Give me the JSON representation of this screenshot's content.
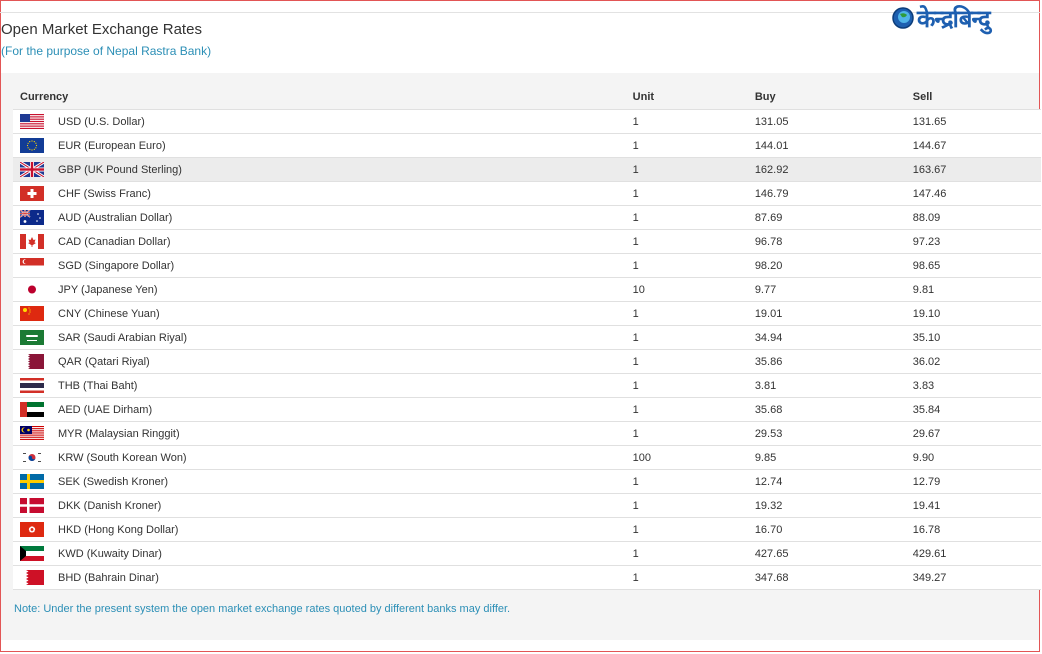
{
  "header": {
    "title": "Open Market Exchange Rates",
    "subtitle": "(For the purpose of Nepal Rastra Bank)",
    "logo_text": "केन्द्रबिन्दु"
  },
  "table": {
    "headers": {
      "currency": "Currency",
      "unit": "Unit",
      "buy": "Buy",
      "sell": "Sell"
    },
    "rows": [
      {
        "flag": "us-flag-icon",
        "currency": "USD (U.S. Dollar)",
        "unit": "1",
        "buy": "131.05",
        "sell": "131.65"
      },
      {
        "flag": "eu-flag-icon",
        "currency": "EUR (European Euro)",
        "unit": "1",
        "buy": "144.01",
        "sell": "144.67"
      },
      {
        "flag": "gb-flag-icon",
        "currency": "GBP (UK Pound Sterling)",
        "unit": "1",
        "buy": "162.92",
        "sell": "163.67"
      },
      {
        "flag": "ch-flag-icon",
        "currency": "CHF (Swiss Franc)",
        "unit": "1",
        "buy": "146.79",
        "sell": "147.46"
      },
      {
        "flag": "au-flag-icon",
        "currency": "AUD (Australian Dollar)",
        "unit": "1",
        "buy": "87.69",
        "sell": "88.09"
      },
      {
        "flag": "ca-flag-icon",
        "currency": "CAD (Canadian Dollar)",
        "unit": "1",
        "buy": "96.78",
        "sell": "97.23"
      },
      {
        "flag": "sg-flag-icon",
        "currency": "SGD (Singapore Dollar)",
        "unit": "1",
        "buy": "98.20",
        "sell": "98.65"
      },
      {
        "flag": "jp-flag-icon",
        "currency": "JPY (Japanese Yen)",
        "unit": "10",
        "buy": "9.77",
        "sell": "9.81"
      },
      {
        "flag": "cn-flag-icon",
        "currency": "CNY (Chinese Yuan)",
        "unit": "1",
        "buy": "19.01",
        "sell": "19.10"
      },
      {
        "flag": "sa-flag-icon",
        "currency": "SAR (Saudi Arabian Riyal)",
        "unit": "1",
        "buy": "34.94",
        "sell": "35.10"
      },
      {
        "flag": "qa-flag-icon",
        "currency": "QAR (Qatari Riyal)",
        "unit": "1",
        "buy": "35.86",
        "sell": "36.02"
      },
      {
        "flag": "th-flag-icon",
        "currency": "THB (Thai Baht)",
        "unit": "1",
        "buy": "3.81",
        "sell": "3.83"
      },
      {
        "flag": "ae-flag-icon",
        "currency": "AED (UAE Dirham)",
        "unit": "1",
        "buy": "35.68",
        "sell": "35.84"
      },
      {
        "flag": "my-flag-icon",
        "currency": "MYR (Malaysian Ringgit)",
        "unit": "1",
        "buy": "29.53",
        "sell": "29.67"
      },
      {
        "flag": "kr-flag-icon",
        "currency": "KRW (South Korean Won)",
        "unit": "100",
        "buy": "9.85",
        "sell": "9.90"
      },
      {
        "flag": "se-flag-icon",
        "currency": "SEK (Swedish Kroner)",
        "unit": "1",
        "buy": "12.74",
        "sell": "12.79"
      },
      {
        "flag": "dk-flag-icon",
        "currency": "DKK (Danish Kroner)",
        "unit": "1",
        "buy": "19.32",
        "sell": "19.41"
      },
      {
        "flag": "hk-flag-icon",
        "currency": "HKD (Hong Kong Dollar)",
        "unit": "1",
        "buy": "16.70",
        "sell": "16.78"
      },
      {
        "flag": "kw-flag-icon",
        "currency": "KWD (Kuwaity Dinar)",
        "unit": "1",
        "buy": "427.65",
        "sell": "429.61"
      },
      {
        "flag": "bh-flag-icon",
        "currency": "BHD (Bahrain Dinar)",
        "unit": "1",
        "buy": "347.68",
        "sell": "349.27"
      }
    ]
  },
  "note": "Note: Under the present system the open market exchange rates quoted by different banks may differ.",
  "colors": {
    "accent_text": "#2c8fb6",
    "logo_blue": "#1d5fb0",
    "panel_bg": "#f4f4f4",
    "highlight_row": "#ececec"
  }
}
